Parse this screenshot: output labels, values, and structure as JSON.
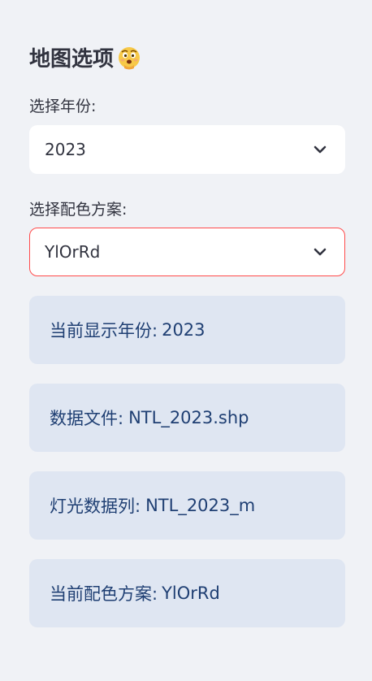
{
  "sidebar": {
    "title": "地图选项",
    "title_emoji": "thinking-face-emoji",
    "year_select": {
      "label": "选择年份:",
      "value": "2023"
    },
    "colormap_select": {
      "label": "选择配色方案:",
      "value": "YlOrRd"
    },
    "info": [
      {
        "label": "当前显示年份:",
        "value": "2023"
      },
      {
        "label": "数据文件:",
        "value": "NTL_2023.shp"
      },
      {
        "label": "灯光数据列:",
        "value": "NTL_2023_m"
      },
      {
        "label": "当前配色方案:",
        "value": "YlOrRd"
      }
    ],
    "colors": {
      "background": "#f0f2f6",
      "info_bg": "#dfe6f2",
      "info_text": "#1f3f73",
      "focus_border": "#ff4b4b"
    }
  }
}
